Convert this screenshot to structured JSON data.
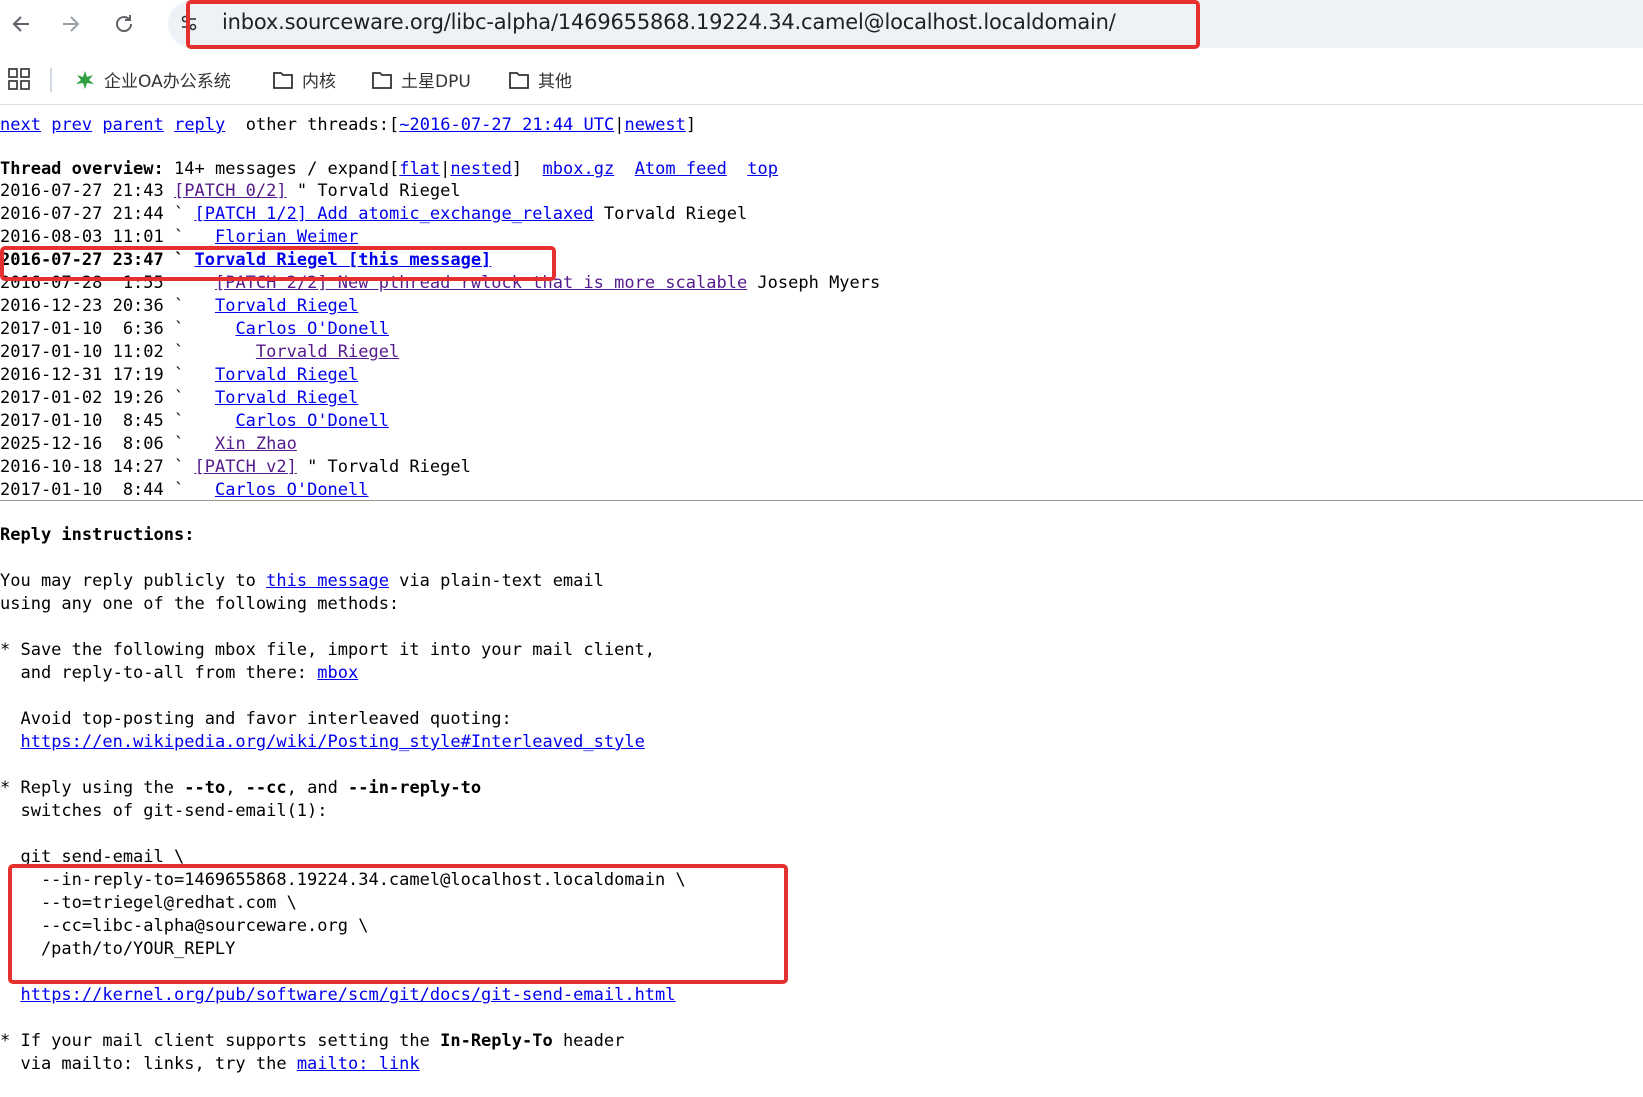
{
  "browser": {
    "url": "inbox.sourceware.org/libc-alpha/1469655868.19224.34.camel@localhost.localdomain/",
    "back_icon": "arrow-left-icon",
    "forward_icon": "arrow-right-icon",
    "reload_icon": "reload-icon"
  },
  "bookmarks": {
    "apps_icon": "apps-grid-icon",
    "items": [
      {
        "label": "企业OA办公系统",
        "icon": "leaf-icon"
      },
      {
        "label": "内核",
        "icon": "folder-icon"
      },
      {
        "label": "土星DPU",
        "icon": "folder-icon"
      },
      {
        "label": "其他",
        "icon": "folder-icon"
      }
    ]
  },
  "topnav": {
    "next": "next",
    "prev": "prev",
    "parent": "parent",
    "reply": "reply",
    "other_threads": "other threads:",
    "prev_thread": "~2016-07-27 21:44 UTC",
    "newest": "newest"
  },
  "overview": {
    "heading": "Thread overview:",
    "summary": "14+ messages / expand",
    "flat": "flat",
    "nested": "nested",
    "mbox_gz": "mbox.gz",
    "atom": "Atom feed",
    "top": "top"
  },
  "thread": [
    {
      "date": "2016-07-27 21:43",
      "indent": "",
      "mark": " ",
      "link": "[PATCH 0/2]",
      "tail": " \" Torvald Riegel",
      "visited": true
    },
    {
      "date": "2016-07-27 21:44",
      "indent": "",
      "mark": " ` ",
      "link": "[PATCH 1/2] Add atomic_exchange_relaxed",
      "tail": " Torvald Riegel",
      "visited": false
    },
    {
      "date": "2016-08-03 11:01",
      "indent": "  ",
      "mark": " ` ",
      "link": "Florian Weimer",
      "tail": "",
      "visited": false
    },
    {
      "date": "2016-07-27 23:47",
      "indent": "",
      "mark": " ` ",
      "link": "Torvald Riegel [this message]",
      "tail": "",
      "visited": false,
      "current": true
    },
    {
      "date": "2016-07-28  1:55",
      "indent": "  ",
      "mark": "   ",
      "link": "[PATCH 2/2] New pthread rwlock that is more scalable",
      "tail": " Joseph Myers",
      "visited": true
    },
    {
      "date": "2016-12-23 20:36",
      "indent": "  ",
      "mark": " ` ",
      "link": "Torvald Riegel",
      "tail": "",
      "visited": false
    },
    {
      "date": "2017-01-10  6:36",
      "indent": "    ",
      "mark": " ` ",
      "link": "Carlos O'Donell",
      "tail": "",
      "visited": false
    },
    {
      "date": "2017-01-10 11:02",
      "indent": "      ",
      "mark": " ` ",
      "link": "Torvald Riegel",
      "tail": "",
      "visited": true
    },
    {
      "date": "2016-12-31 17:19",
      "indent": "  ",
      "mark": " ` ",
      "link": "Torvald Riegel",
      "tail": "",
      "visited": false
    },
    {
      "date": "2017-01-02 19:26",
      "indent": "  ",
      "mark": " ` ",
      "link": "Torvald Riegel",
      "tail": "",
      "visited": false
    },
    {
      "date": "2017-01-10  8:45",
      "indent": "    ",
      "mark": " ` ",
      "link": "Carlos O'Donell",
      "tail": "",
      "visited": false
    },
    {
      "date": "2025-12-16  8:06",
      "indent": "  ",
      "mark": " ` ",
      "link": "Xin Zhao",
      "tail": "",
      "visited": true
    },
    {
      "date": "2016-10-18 14:27",
      "indent": "",
      "mark": " ` ",
      "link": "[PATCH v2]",
      "tail": " \" Torvald Riegel",
      "visited": true
    },
    {
      "date": "2017-01-10  8:44",
      "indent": "  ",
      "mark": " ` ",
      "link": "Carlos O'Donell",
      "tail": "",
      "visited": false
    }
  ],
  "reply": {
    "heading": "Reply instructions:",
    "p1a": "You may reply publicly to ",
    "p1_link": "this message",
    "p1b": " via plain-text email",
    "p2": "using any one of the following methods:",
    "s1a": "* Save the following mbox file, import it into your mail client,",
    "s1b": "  and reply-to-all from there: ",
    "s1_link": "mbox",
    "s2": "  Avoid top-posting and favor interleaved quoting:",
    "wiki_link": "https://en.wikipedia.org/wiki/Posting_style#Interleaved_style",
    "s3a": "* Reply using the ",
    "s3_to": "--to",
    "s3_sep1": ", ",
    "s3_cc": "--cc",
    "s3_sep2": ", and ",
    "s3_irt": "--in-reply-to",
    "s3b": "  switches of git-send-email(1):",
    "cmd": [
      "  git send-email \\",
      "    --in-reply-to=1469655868.19224.34.camel@localhost.localdomain \\",
      "    --to=triegel@redhat.com \\",
      "    --cc=libc-alpha@sourceware.org \\",
      "    /path/to/YOUR_REPLY"
    ],
    "git_link": "https://kernel.org/pub/software/scm/git/docs/git-send-email.html",
    "s4a": "* If your mail client supports setting the ",
    "s4_bold": "In-Reply-To",
    "s4b": " header",
    "s4c": "  via mailto: links, try the ",
    "s4_link": "mailto: link"
  }
}
